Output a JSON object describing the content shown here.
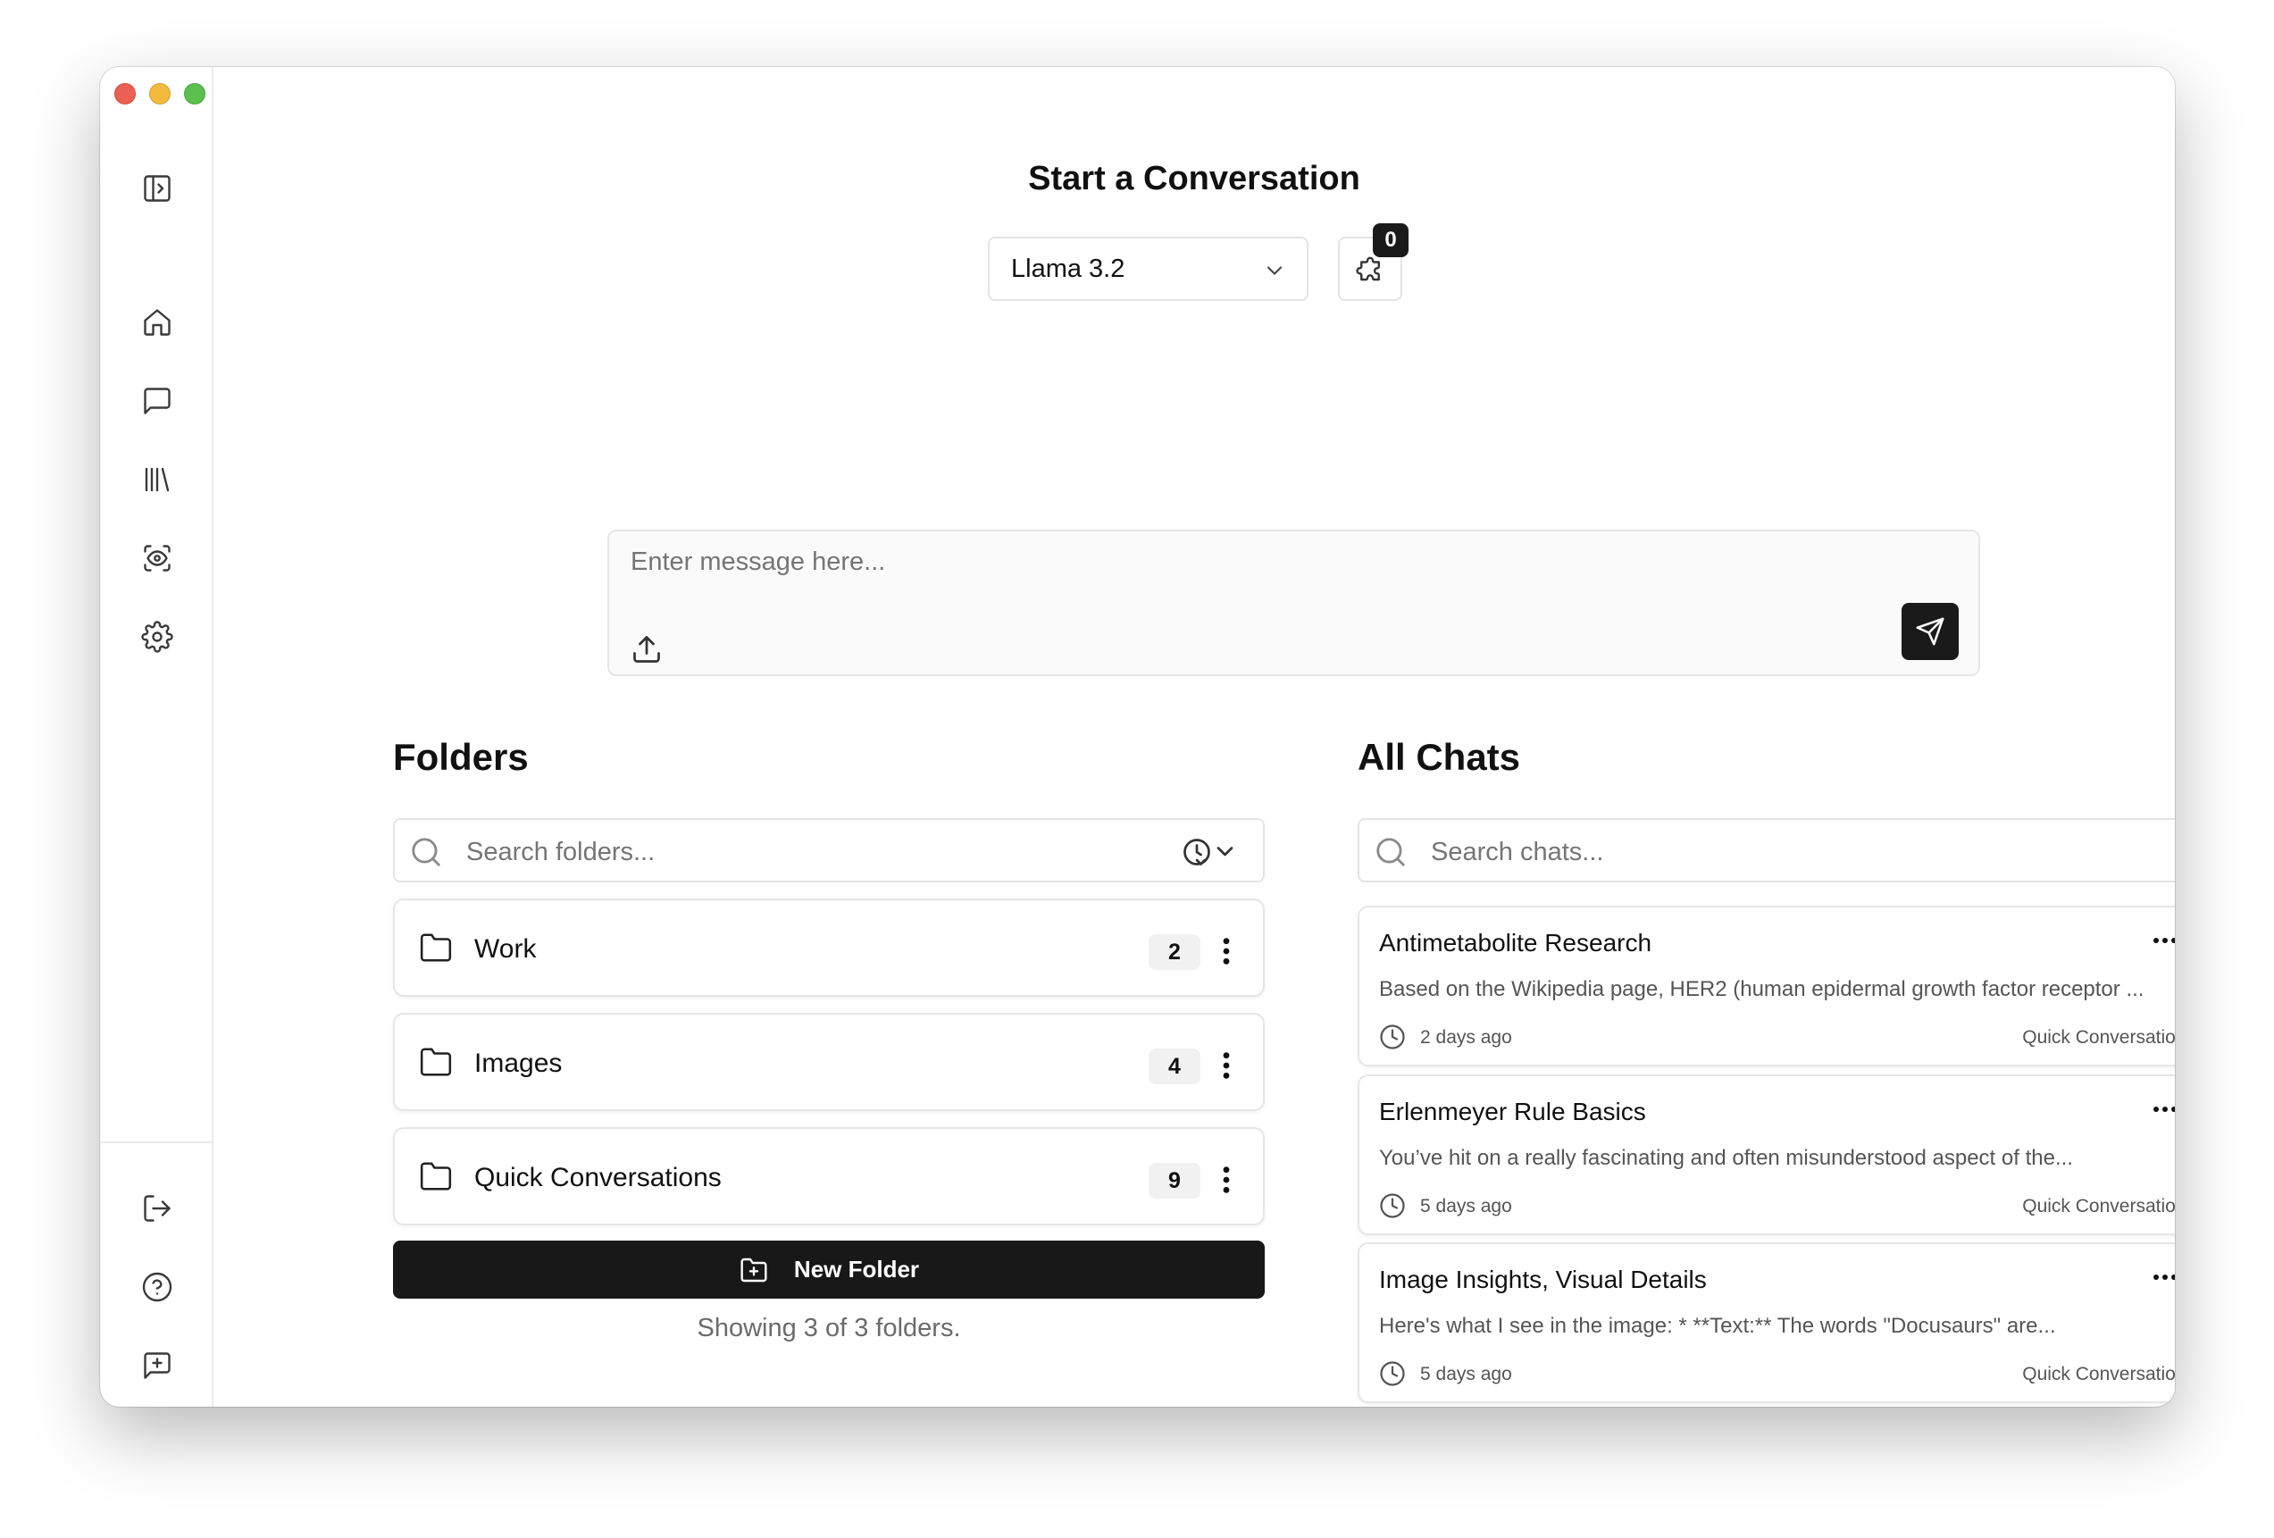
{
  "header": {
    "title": "Start a Conversation",
    "model_selected": "Llama 3.2",
    "plugins_count": "0"
  },
  "composer": {
    "placeholder": "Enter message here..."
  },
  "folders": {
    "title": "Folders",
    "search_placeholder": "Search folders...",
    "items": [
      {
        "name": "Work",
        "count": "2"
      },
      {
        "name": "Images",
        "count": "4"
      },
      {
        "name": "Quick Conversations",
        "count": "9"
      }
    ],
    "new_folder_label": "New Folder",
    "footer": "Showing 3 of 3 folders."
  },
  "chats": {
    "title": "All Chats",
    "search_placeholder": "Search chats...",
    "items": [
      {
        "title": "Antimetabolite Research",
        "preview": "Based on the Wikipedia page, HER2 (human epidermal growth factor receptor ...",
        "time": "2 days ago",
        "folder": "Quick Conversations"
      },
      {
        "title": "Erlenmeyer Rule Basics",
        "preview": "You’ve hit on a really fascinating and often misunderstood aspect of the...",
        "time": "5 days ago",
        "folder": "Quick Conversations"
      },
      {
        "title": "Image Insights, Visual Details",
        "preview": "Here's what I see in the image: * **Text:** The words \"Docusaurs\" are...",
        "time": "5 days ago",
        "folder": "Quick Conversations"
      }
    ]
  },
  "sidebar": {
    "icons": [
      "sidebar-toggle-icon",
      "home-icon",
      "chat-icon",
      "library-icon",
      "scan-eye-icon",
      "gear-icon",
      "logout-icon",
      "help-icon",
      "feedback-icon"
    ]
  },
  "colors": {
    "accent": "#181818",
    "border": "#e6e6e6",
    "muted_text": "#6b6b6b"
  }
}
